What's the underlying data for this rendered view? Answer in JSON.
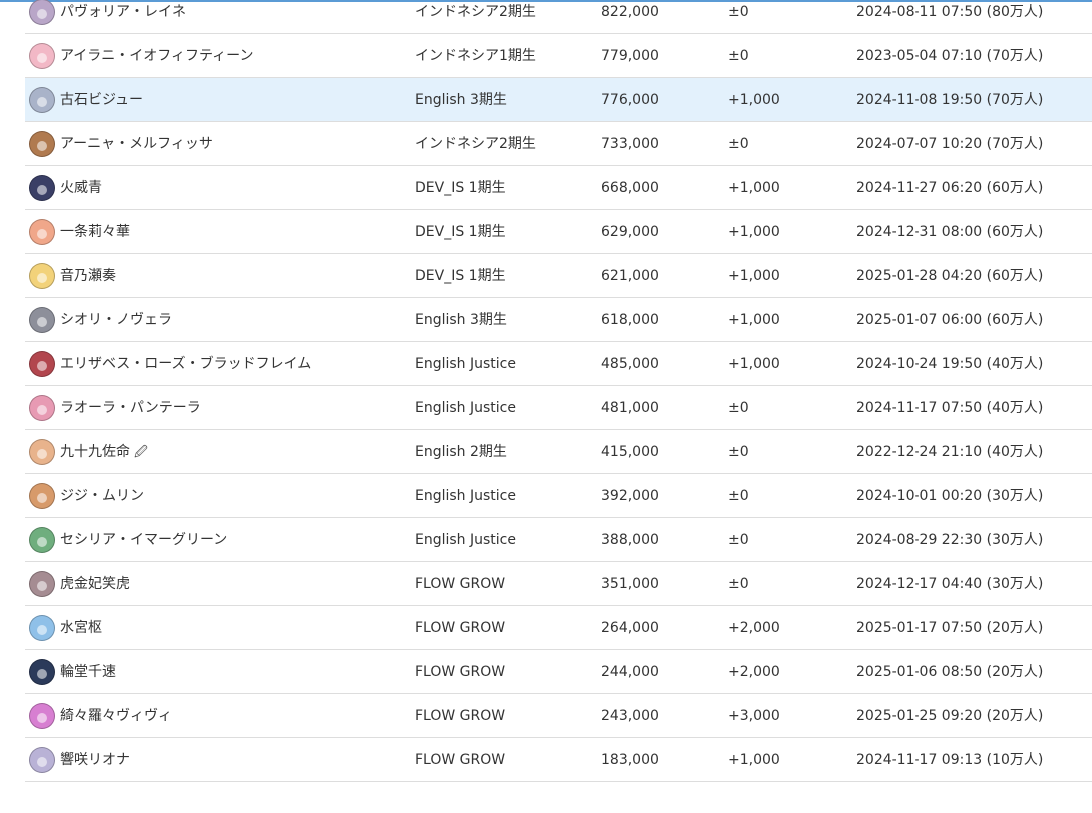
{
  "rows": [
    {
      "name": "パヴォリア・レイネ",
      "group": "インドネシア2期生",
      "subscribers": "822,000",
      "change": "±0",
      "date": "2024-08-11 07:50 (80万人)",
      "avatar_color": "#b9a6c8"
    },
    {
      "name": "アイラニ・イオフィフティーン",
      "group": "インドネシア1期生",
      "subscribers": "779,000",
      "change": "±0",
      "date": "2023-05-04 07:10 (70万人)",
      "avatar_color": "#f2b8c6"
    },
    {
      "name": "古石ビジュー",
      "group": "English 3期生",
      "subscribers": "776,000",
      "change": "+1,000",
      "date": "2024-11-08 19:50 (70万人)",
      "avatar_color": "#a9b3c9"
    },
    {
      "name": "アーニャ・メルフィッサ",
      "group": "インドネシア2期生",
      "subscribers": "733,000",
      "change": "±0",
      "date": "2024-07-07 10:20 (70万人)",
      "avatar_color": "#b07a4f"
    },
    {
      "name": "火威青",
      "group": "DEV_IS 1期生",
      "subscribers": "668,000",
      "change": "+1,000",
      "date": "2024-11-27 06:20 (60万人)",
      "avatar_color": "#3a3f66"
    },
    {
      "name": "一条莉々華",
      "group": "DEV_IS 1期生",
      "subscribers": "629,000",
      "change": "+1,000",
      "date": "2024-12-31 08:00 (60万人)",
      "avatar_color": "#f0a78a"
    },
    {
      "name": "音乃瀬奏",
      "group": "DEV_IS 1期生",
      "subscribers": "621,000",
      "change": "+1,000",
      "date": "2025-01-28 04:20 (60万人)",
      "avatar_color": "#f2d27a"
    },
    {
      "name": "シオリ・ノヴェラ",
      "group": "English 3期生",
      "subscribers": "618,000",
      "change": "+1,000",
      "date": "2025-01-07 06:00 (60万人)",
      "avatar_color": "#8d8f9a"
    },
    {
      "name": "エリザベス・ローズ・ブラッドフレイム",
      "group": "English Justice",
      "subscribers": "485,000",
      "change": "+1,000",
      "date": "2024-10-24 19:50 (40万人)",
      "avatar_color": "#b2464e"
    },
    {
      "name": "ラオーラ・パンテーラ",
      "group": "English Justice",
      "subscribers": "481,000",
      "change": "±0",
      "date": "2024-11-17 07:50 (40万人)",
      "avatar_color": "#e79ab3"
    },
    {
      "name": "九十九佐命",
      "pin": "🖉",
      "group": "English 2期生",
      "subscribers": "415,000",
      "change": "±0",
      "date": "2022-12-24 21:10 (40万人)",
      "avatar_color": "#e8b38c"
    },
    {
      "name": "ジジ・ムリン",
      "group": "English Justice",
      "subscribers": "392,000",
      "change": "±0",
      "date": "2024-10-01 00:20 (30万人)",
      "avatar_color": "#d79a6a"
    },
    {
      "name": "セシリア・イマーグリーン",
      "group": "English Justice",
      "subscribers": "388,000",
      "change": "±0",
      "date": "2024-08-29 22:30 (30万人)",
      "avatar_color": "#6fae7e"
    },
    {
      "name": "虎金妃笑虎",
      "group": "FLOW GROW",
      "subscribers": "351,000",
      "change": "±0",
      "date": "2024-12-17 04:40 (30万人)",
      "avatar_color": "#a58c92"
    },
    {
      "name": "水宮枢",
      "group": "FLOW GROW",
      "subscribers": "264,000",
      "change": "+2,000",
      "date": "2025-01-17 07:50 (20万人)",
      "avatar_color": "#8fc0e8"
    },
    {
      "name": "輪堂千速",
      "group": "FLOW GROW",
      "subscribers": "244,000",
      "change": "+2,000",
      "date": "2025-01-06 08:50 (20万人)",
      "avatar_color": "#2b3a5a"
    },
    {
      "name": "綺々羅々ヴィヴィ",
      "group": "FLOW GROW",
      "subscribers": "243,000",
      "change": "+3,000",
      "date": "2025-01-25 09:20 (20万人)",
      "avatar_color": "#d77fd1"
    },
    {
      "name": "響咲リオナ",
      "group": "FLOW GROW",
      "subscribers": "183,000",
      "change": "+1,000",
      "date": "2024-11-17 09:13 (10万人)",
      "avatar_color": "#b9b2d6"
    }
  ],
  "highlight_row_color": "#e3f1fc",
  "accent_color": "#5b9bd5"
}
